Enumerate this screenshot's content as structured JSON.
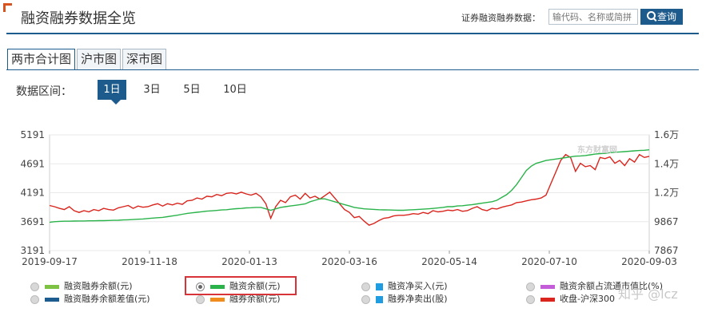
{
  "header": {
    "title": "融资融券数据全览",
    "search_label": "证券融资融券数据：",
    "search_placeholder": "输代码、名称或简拼",
    "search_button": "查询"
  },
  "tabs": [
    {
      "label": "两市合计图",
      "active": true
    },
    {
      "label": "沪市图",
      "active": false
    },
    {
      "label": "深市图",
      "active": false
    }
  ],
  "range": {
    "label": "数据区间：",
    "options": [
      {
        "label": "1日",
        "active": true
      },
      {
        "label": "3日",
        "active": false
      },
      {
        "label": "5日",
        "active": false
      },
      {
        "label": "10日",
        "active": false
      }
    ]
  },
  "chart_data": {
    "type": "line",
    "logo": "东方财富网",
    "x_ticks": [
      "2019-09-17",
      "2019-11-18",
      "2020-01-13",
      "2020-03-16",
      "2020-05-14",
      "2020-07-10",
      "2020-09-03"
    ],
    "y_left_ticks": [
      "5191",
      "4691",
      "4191",
      "3691",
      "3191"
    ],
    "y_right_ticks": [
      "1.6万",
      "1.4万",
      "1.2万",
      "9867",
      "7867"
    ],
    "y_left_range": [
      3191,
      5191
    ],
    "y_right_range": [
      7867,
      16000
    ],
    "series": [
      {
        "name": "收盘-沪深300",
        "axis": "left",
        "color": "#d9251d",
        "values": [
          3970,
          3950,
          3920,
          3900,
          3950,
          3880,
          3850,
          3880,
          3860,
          3900,
          3880,
          3920,
          3900,
          3890,
          3930,
          3950,
          3970,
          3920,
          3960,
          3940,
          3950,
          3980,
          4000,
          3960,
          4000,
          3980,
          4010,
          3990,
          4050,
          4060,
          4100,
          4080,
          4130,
          4120,
          4160,
          4140,
          4180,
          4190,
          4170,
          4200,
          4170,
          4150,
          4180,
          4120,
          4000,
          3750,
          3950,
          4060,
          4020,
          4120,
          4150,
          4080,
          4180,
          4100,
          4130,
          4080,
          4140,
          4200,
          4100,
          4000,
          3900,
          3850,
          3760,
          3780,
          3700,
          3630,
          3660,
          3710,
          3750,
          3760,
          3790,
          3800,
          3800,
          3810,
          3830,
          3820,
          3850,
          3830,
          3880,
          3860,
          3870,
          3890,
          3880,
          3900,
          3870,
          3880,
          3920,
          3950,
          3900,
          3880,
          3920,
          3910,
          3940,
          3960,
          3980,
          4020,
          4030,
          4050,
          4070,
          4080,
          4100,
          4150,
          4350,
          4550,
          4750,
          4850,
          4800,
          4560,
          4700,
          4640,
          4660,
          4590,
          4800,
          4780,
          4810,
          4700,
          4750,
          4660,
          4780,
          4720,
          4850,
          4800,
          4820
        ]
      },
      {
        "name": "融资余额(元)",
        "axis": "right",
        "color": "#2ab34a",
        "values": [
          9850,
          9900,
          9920,
          9930,
          9930,
          9940,
          9950,
          9950,
          9960,
          9960,
          9970,
          9970,
          9980,
          9990,
          10000,
          10020,
          10030,
          10050,
          10070,
          10090,
          10120,
          10150,
          10180,
          10200,
          10250,
          10300,
          10350,
          10420,
          10480,
          10520,
          10560,
          10600,
          10640,
          10660,
          10690,
          10720,
          10740,
          10780,
          10810,
          10830,
          10870,
          10880,
          10900,
          10900,
          10800,
          10700,
          10800,
          10900,
          10950,
          11000,
          11050,
          11100,
          11150,
          11300,
          11400,
          11500,
          11500,
          11400,
          11300,
          11200,
          11100,
          11000,
          10900,
          10850,
          10800,
          10780,
          10760,
          10740,
          10730,
          10720,
          10710,
          10700,
          10700,
          10720,
          10740,
          10760,
          10780,
          10800,
          10830,
          10860,
          10900,
          10950,
          10950,
          11000,
          11020,
          11060,
          11100,
          11150,
          11200,
          11250,
          11300,
          11400,
          11600,
          11800,
          12100,
          12500,
          13000,
          13500,
          13800,
          14000,
          14100,
          14200,
          14250,
          14300,
          14350,
          14400,
          14450,
          14500,
          14520,
          14550,
          14600,
          14650,
          14680,
          14700,
          14750,
          14780,
          14800,
          14820,
          14850,
          14880,
          14900,
          14920,
          14950
        ]
      }
    ]
  },
  "legend": [
    {
      "label": "融资融券余额(元)",
      "color": "#7dc242",
      "style": "line",
      "selected": false
    },
    {
      "label": "融资余额(元)",
      "color": "#2ab34a",
      "style": "line",
      "selected": true
    },
    {
      "label": "融资净买入(元)",
      "color": "#1f9de0",
      "style": "square",
      "selected": false
    },
    {
      "label": "融资余额占流通市值比(%)",
      "color": "#c45ed8",
      "style": "line",
      "selected": false
    },
    {
      "label": "融资融券余额差值(元)",
      "color": "#1c5c8f",
      "style": "line",
      "selected": false
    },
    {
      "label": "融券余额(元)",
      "color": "#f08c1e",
      "style": "line",
      "selected": false
    },
    {
      "label": "融券净卖出(股)",
      "color": "#1f9de0",
      "style": "square",
      "selected": false
    },
    {
      "label": "收盘-沪深300",
      "color": "#d9251d",
      "style": "line",
      "selected": false
    }
  ],
  "watermark": "知乎 @lcz"
}
